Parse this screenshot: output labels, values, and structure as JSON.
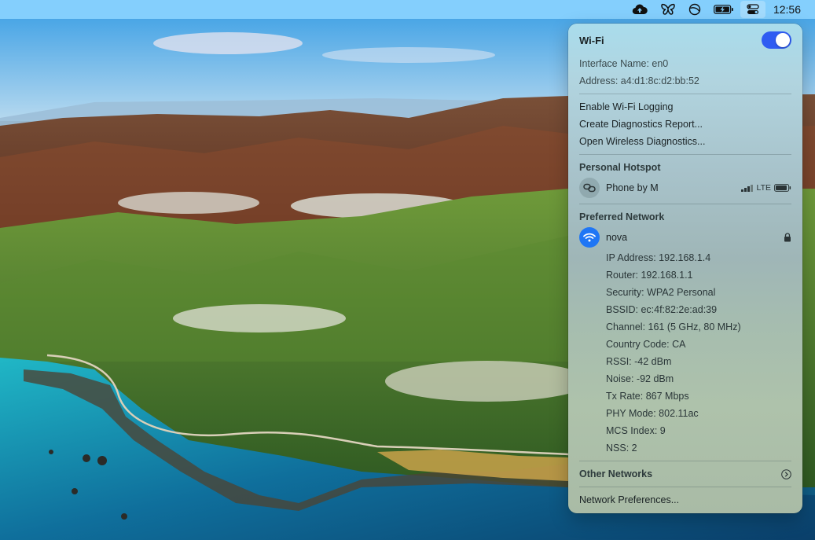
{
  "menubar": {
    "icons": [
      "cloud-upload-icon",
      "butterfly-icon",
      "do-not-disturb-icon",
      "battery-charging-icon",
      "control-center-icon"
    ],
    "clock": "12:56"
  },
  "wifi_panel": {
    "title": "Wi-Fi",
    "toggle_on": true,
    "interface_name": "Interface Name: en0",
    "address": "Address: a4:d1:8c:d2:bb:52",
    "actions": [
      "Enable Wi-Fi Logging",
      "Create Diagnostics Report...",
      "Open Wireless Diagnostics..."
    ],
    "hotspot": {
      "section_label": "Personal Hotspot",
      "name": "Phone by M",
      "network_type": "LTE",
      "signal_bars": 3,
      "signal_bars_total": 4
    },
    "preferred": {
      "section_label": "Preferred Network",
      "name": "nova",
      "locked": true,
      "details": [
        "IP Address: 192.168.1.4",
        "Router: 192.168.1.1",
        "Security: WPA2 Personal",
        "BSSID: ec:4f:82:2e:ad:39",
        "Channel: 161 (5 GHz, 80 MHz)",
        "Country Code: CA",
        "RSSI: -42 dBm",
        "Noise: -92 dBm",
        "Tx Rate: 867 Mbps",
        "PHY Mode: 802.11ac",
        "MCS Index: 9",
        "NSS: 2"
      ]
    },
    "other_networks": "Other Networks",
    "network_preferences": "Network Preferences..."
  },
  "colors": {
    "accent": "#2f5cf2",
    "wifi_icon_bg": "#1f76f5",
    "menubar": "#84cffd"
  }
}
